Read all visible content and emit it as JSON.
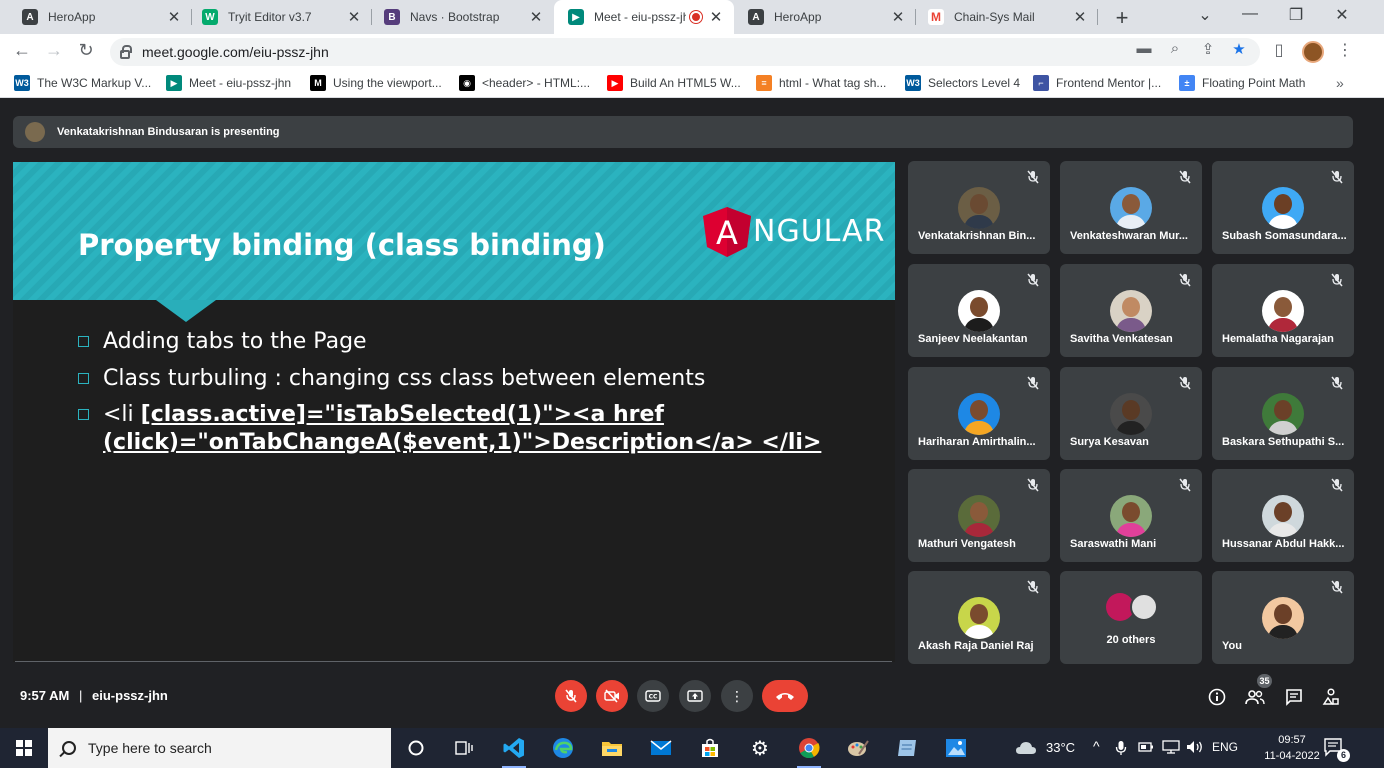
{
  "browser": {
    "tabs": [
      {
        "title": "HeroApp",
        "icon": "angular-icon",
        "color": "#3c4043"
      },
      {
        "title": "Tryit Editor v3.7",
        "icon": "w3schools-icon",
        "color": "#04aa6d"
      },
      {
        "title": "Navs · Bootstrap",
        "icon": "bootstrap-icon",
        "color": "#563d7c"
      },
      {
        "title": "Meet - eiu-pssz-jh",
        "icon": "google-meet-icon",
        "color": "#00897b",
        "active": true
      },
      {
        "title": "HeroApp",
        "icon": "angular-icon",
        "color": "#3c4043"
      },
      {
        "title": "Chain-Sys Mail",
        "icon": "gmail-icon",
        "color": "#ea4335"
      }
    ],
    "url": "meet.google.com/eiu-pssz-jhn",
    "bookmarks": [
      {
        "label": "The W3C Markup V...",
        "icon": "w3c-icon",
        "color": "#005a9c"
      },
      {
        "label": "Meet - eiu-pssz-jhn",
        "icon": "google-meet-icon",
        "color": "#00897b"
      },
      {
        "label": "Using the viewport...",
        "icon": "mdn-icon",
        "color": "#000000"
      },
      {
        "label": "<header> - HTML:...",
        "icon": "mdn-icon",
        "color": "#000000"
      },
      {
        "label": "Build An HTML5 W...",
        "icon": "youtube-icon",
        "color": "#ff0000"
      },
      {
        "label": "html - What tag sh...",
        "icon": "stackoverflow-icon",
        "color": "#f48024"
      },
      {
        "label": "Selectors Level 4",
        "icon": "w3c-icon",
        "color": "#005a9c"
      },
      {
        "label": "Frontend Mentor |...",
        "icon": "frontend-mentor-icon",
        "color": "#3e54a3"
      },
      {
        "label": "Floating Point Math",
        "icon": "calculator-icon",
        "color": "#4285f4"
      }
    ]
  },
  "meet": {
    "presenting": "Venkatakrishnan Bindusaran is presenting",
    "slide": {
      "title": "Property binding (class binding)",
      "logo": "NGULAR",
      "logo_letter": "A",
      "bullets": [
        {
          "text": "Adding tabs to the Page"
        },
        {
          "text": "Class turbuling : changing css class between elements"
        },
        {
          "prefix": "<li ",
          "bold": "[class.active]=\"isTabSelected(1)\"><a href",
          "line2": "(click)=\"onTabChangeA($event,1)\">Description</a> </li>"
        }
      ]
    },
    "participants": [
      {
        "name": "Venkatakrishnan Bin...",
        "bg": "#6b5e45",
        "skin": "#6a4a32",
        "shirt": "#2f3a4a"
      },
      {
        "name": "Venkateshwaran Mur...",
        "bg": "#5aa9e6",
        "skin": "#8a5a3a",
        "shirt": "#e8eef5"
      },
      {
        "name": "Subash Somasundara...",
        "bg": "#3fa9f5",
        "skin": "#6b3f25",
        "shirt": "#ffffff"
      },
      {
        "name": "Sanjeev Neelakantan",
        "bg": "#ffffff",
        "skin": "#7a4b2e",
        "shirt": "#1c1c1c"
      },
      {
        "name": "Savitha Venkatesan",
        "bg": "#d9d2c5",
        "skin": "#c08a63",
        "shirt": "#7a5a8a"
      },
      {
        "name": "Hemalatha Nagarajan",
        "bg": "#ffffff",
        "skin": "#8a5a3a",
        "shirt": "#b0283a"
      },
      {
        "name": "Hariharan Amirthalin...",
        "bg": "#1e88e5",
        "skin": "#7a4b2e",
        "shirt": "#f5a623"
      },
      {
        "name": "Surya Kesavan",
        "bg": "#4a4a4a",
        "skin": "#5a3a25",
        "shirt": "#222222"
      },
      {
        "name": "Baskara Sethupathi S...",
        "bg": "#3f7a3a",
        "skin": "#6b4028",
        "shirt": "#d0d0d0"
      },
      {
        "name": "Mathuri Vengatesh",
        "bg": "#5a6b3a",
        "skin": "#8a5a3a",
        "shirt": "#a8283a"
      },
      {
        "name": "Saraswathi Mani",
        "bg": "#8aa87a",
        "skin": "#7a4b2e",
        "shirt": "#e0409a"
      },
      {
        "name": "Hussanar Abdul Hakk...",
        "bg": "#cfd8dc",
        "skin": "#6b4028",
        "shirt": "#e8e8e8"
      },
      {
        "name": "Akash Raja Daniel Raj",
        "bg": "#c8d64a",
        "skin": "#7a4b2e",
        "shirt": "#ffffff"
      },
      {
        "name": "You",
        "bg": "#f2c8a0",
        "skin": "#6b4028",
        "shirt": "#222222"
      }
    ],
    "others_label": "20 others",
    "time": "9:57 AM",
    "separator": "|",
    "meeting_code": "eiu-pssz-jhn",
    "people_count": "35"
  },
  "taskbar": {
    "search_placeholder": "Type here to search",
    "weather": "33°C",
    "language": "ENG",
    "time": "09:57",
    "date": "11-04-2022",
    "notifications": "6"
  }
}
